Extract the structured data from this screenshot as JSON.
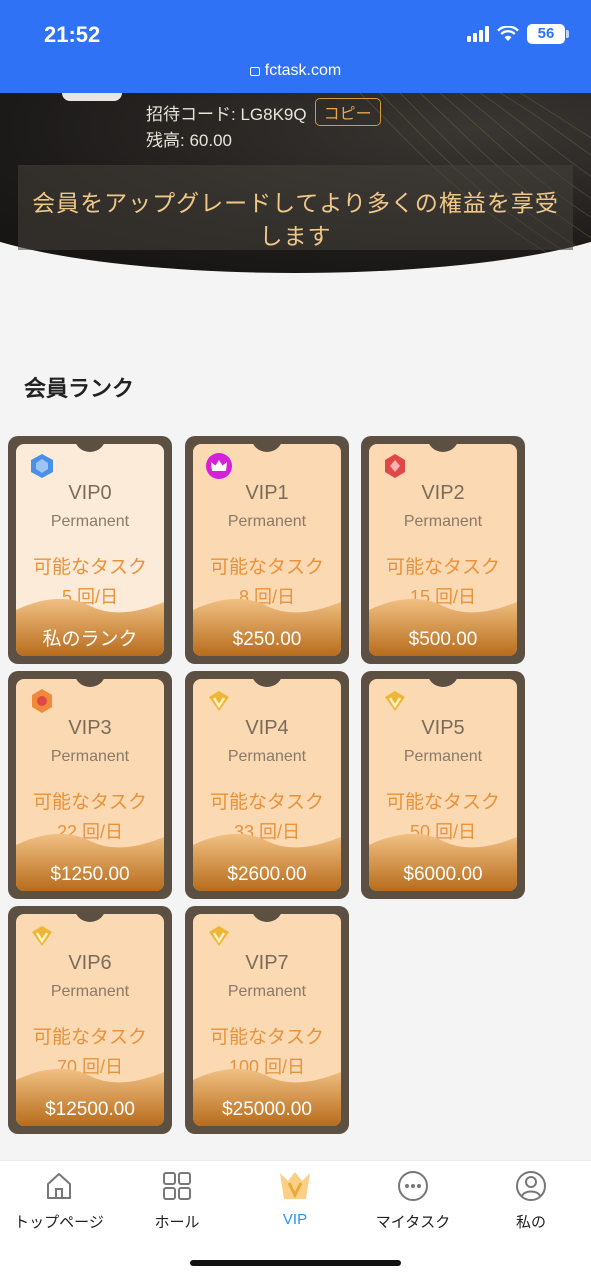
{
  "status_bar": {
    "time": "21:52",
    "battery": "56",
    "url": "fctask.com"
  },
  "profile": {
    "invite_label": "招待コード: LG8K9Q",
    "copy_label": "コピー",
    "balance_label": "残高: 60.00",
    "upgrade_text": "会員をアップグレードしてより多くの権益を享受します"
  },
  "section_title": "会員ランク",
  "cards": [
    {
      "name": "VIP0",
      "period": "Permanent",
      "tasks_label": "可能なタスク",
      "tasks": "5 回/日",
      "price": "私のランク",
      "badge": "hexagon-gem-badge-icon",
      "badge_color": "#4a8fe8"
    },
    {
      "name": "VIP1",
      "period": "Permanent",
      "tasks_label": "可能なタスク",
      "tasks": "8 回/日",
      "price": "$250.00",
      "badge": "crown-badge-icon",
      "badge_color": "#d61fd8"
    },
    {
      "name": "VIP2",
      "period": "Permanent",
      "tasks_label": "可能なタスク",
      "tasks": "15 回/日",
      "price": "$500.00",
      "badge": "red-gem-badge-icon",
      "badge_color": "#e04848"
    },
    {
      "name": "VIP3",
      "period": "Permanent",
      "tasks_label": "可能なタスク",
      "tasks": "22 回/日",
      "price": "$1250.00",
      "badge": "orange-medal-badge-icon",
      "badge_color": "#f08a3a"
    },
    {
      "name": "VIP4",
      "period": "Permanent",
      "tasks_label": "可能なタスク",
      "tasks": "33 回/日",
      "price": "$2600.00",
      "badge": "gold-v-badge-icon",
      "badge_color": "#f0b535"
    },
    {
      "name": "VIP5",
      "period": "Permanent",
      "tasks_label": "可能なタスク",
      "tasks": "50 回/日",
      "price": "$6000.00",
      "badge": "gold-v-badge-icon",
      "badge_color": "#f0b535"
    },
    {
      "name": "VIP6",
      "period": "Permanent",
      "tasks_label": "可能なタスク",
      "tasks": "70 回/日",
      "price": "$12500.00",
      "badge": "gold-v-badge-icon",
      "badge_color": "#f0b535"
    },
    {
      "name": "VIP7",
      "period": "Permanent",
      "tasks_label": "可能なタスク",
      "tasks": "100 回/日",
      "price": "$25000.00",
      "badge": "gold-v-badge-icon",
      "badge_color": "#f0b535"
    }
  ],
  "tabs": [
    {
      "label": "トップページ",
      "icon": "home-icon"
    },
    {
      "label": "ホール",
      "icon": "grid-icon"
    },
    {
      "label": "VIP",
      "icon": "vip-crown-icon",
      "active": true
    },
    {
      "label": "マイタスク",
      "icon": "more-dots-icon"
    },
    {
      "label": "私の",
      "icon": "user-icon"
    }
  ],
  "colors": {
    "header_blue": "#2f72f5",
    "accent_orange": "#e8923a",
    "tab_active": "#2f8df5",
    "card_frame": "#5c5042"
  }
}
